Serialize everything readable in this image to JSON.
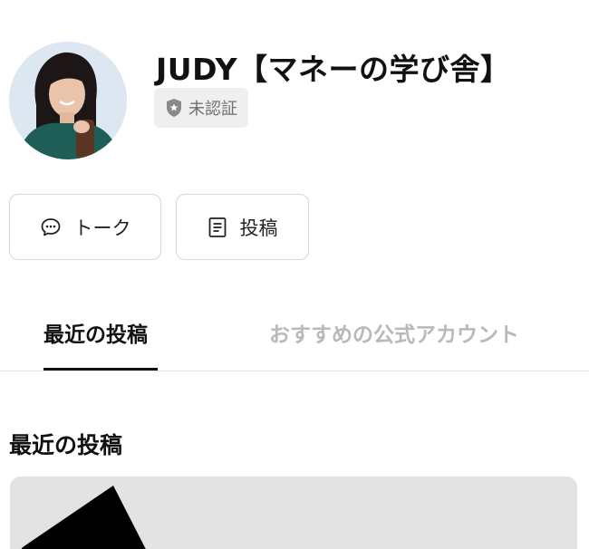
{
  "profile": {
    "name": "JUDY【マネーの学び舎】",
    "verification_label": "未認証"
  },
  "actions": {
    "talk_label": "トーク",
    "posts_label": "投稿"
  },
  "tabs": [
    {
      "label": "最近の投稿",
      "active": true
    },
    {
      "label": "おすすめの公式アカウント",
      "active": false
    }
  ],
  "section": {
    "heading": "最近の投稿"
  },
  "colors": {
    "active_tab": "#111111",
    "inactive_tab": "#b9b9b9",
    "badge_bg": "#efefef",
    "card_bg": "#e3e3e3"
  },
  "icons": {
    "talk": "speech-bubble-icon",
    "posts": "document-icon",
    "verification": "shield-icon"
  }
}
